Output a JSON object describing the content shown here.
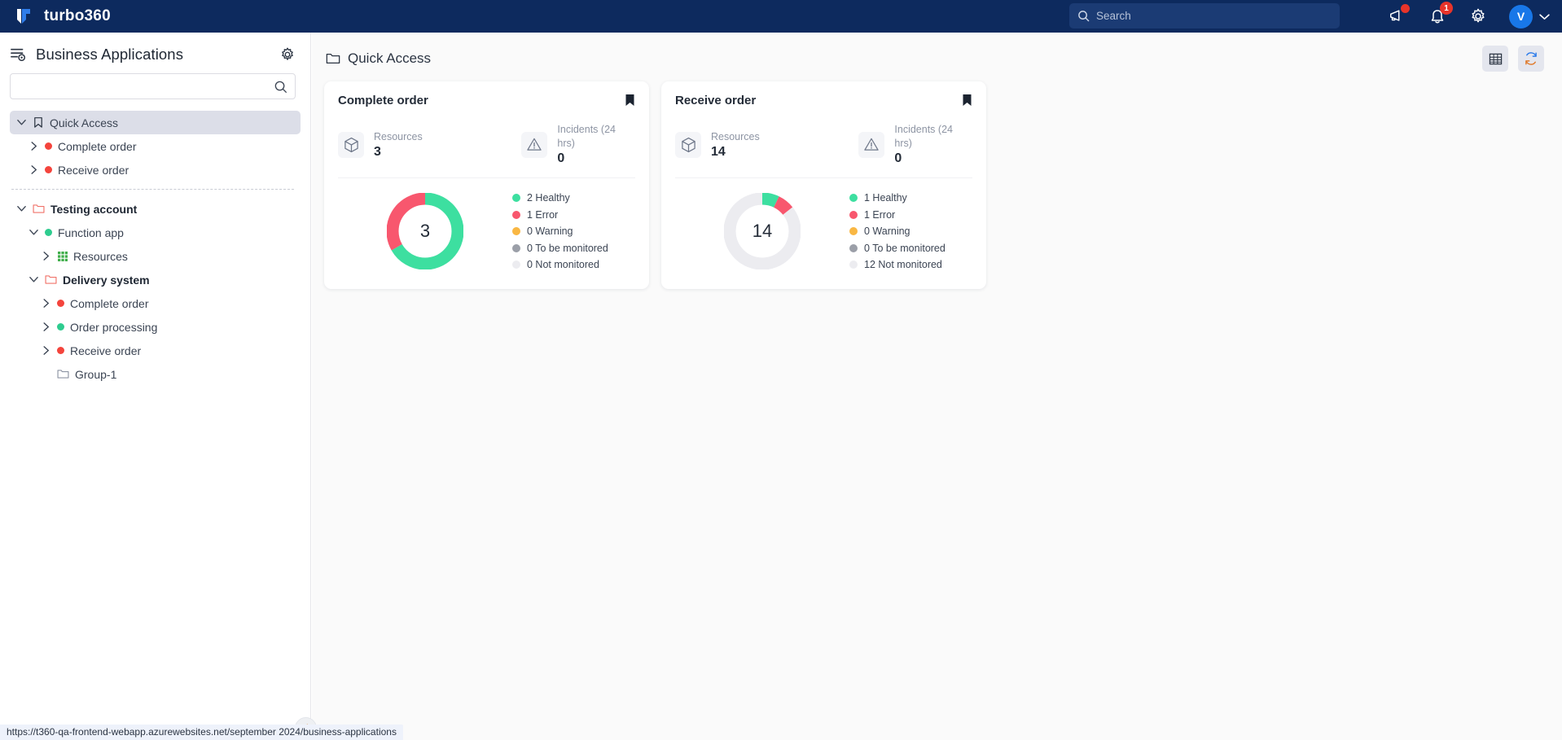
{
  "topbar": {
    "brand": "turbo360",
    "logo_icon": "turbo360-logo-icon",
    "search": {
      "value": "",
      "placeholder": "Search",
      "icon": "search-icon"
    },
    "megaphone": {
      "icon": "megaphone-icon",
      "has_alert": true
    },
    "notifications": {
      "icon": "bell-icon",
      "badge": "1"
    },
    "settings": {
      "icon": "gear-icon"
    },
    "avatar": {
      "initial": "V",
      "chevron": "chevron-down-icon",
      "color": "#1877e8"
    }
  },
  "sidebar": {
    "title": "Business Applications",
    "title_icon": "business-applications-icon",
    "gear_icon": "gear-icon",
    "search": {
      "value": "",
      "placeholder": "",
      "icon": "search-icon"
    },
    "collapse_icon": "chevron-left-icon",
    "tree": [
      {
        "label": "Quick Access",
        "icon": "bookmark-icon",
        "chevron": "chevron-down-icon",
        "indent": 0,
        "selected": true,
        "bold": false,
        "status": null
      },
      {
        "label": "Complete order",
        "icon": null,
        "chevron": "chevron-right-icon",
        "indent": 1,
        "selected": false,
        "bold": false,
        "status": "#f4443c"
      },
      {
        "label": "Receive order",
        "icon": null,
        "chevron": "chevron-right-icon",
        "indent": 1,
        "selected": false,
        "bold": false,
        "status": "#f4443c"
      },
      {
        "separator": true
      },
      {
        "label": "Testing account",
        "icon": "folder-icon",
        "icon_color": "#f0736a",
        "chevron": "chevron-down-icon",
        "indent": 0,
        "selected": false,
        "bold": true,
        "status": null
      },
      {
        "label": "Function app",
        "icon": null,
        "chevron": "chevron-down-icon",
        "indent": 1,
        "selected": false,
        "bold": false,
        "status": "#2ecc8f"
      },
      {
        "label": "Resources",
        "icon": "grid-icon",
        "icon_color": "#3fae4a",
        "chevron": "chevron-right-icon",
        "indent": 2,
        "selected": false,
        "bold": false,
        "status": null
      },
      {
        "label": "Delivery system",
        "icon": "folder-icon",
        "icon_color": "#f0736a",
        "chevron": "chevron-down-icon",
        "indent": 1,
        "selected": false,
        "bold": true,
        "status": null
      },
      {
        "label": "Complete order",
        "icon": null,
        "chevron": "chevron-right-icon",
        "indent": 2,
        "selected": false,
        "bold": false,
        "status": "#f4443c"
      },
      {
        "label": "Order processing",
        "icon": null,
        "chevron": "chevron-right-icon",
        "indent": 2,
        "selected": false,
        "bold": false,
        "status": "#2ecc8f"
      },
      {
        "label": "Receive order",
        "icon": null,
        "chevron": "chevron-right-icon",
        "indent": 2,
        "selected": false,
        "bold": false,
        "status": "#f4443c"
      },
      {
        "label": "Group-1",
        "icon": "folder-icon",
        "icon_color": "#8d94a3",
        "chevron": null,
        "indent": 2,
        "selected": false,
        "bold": false,
        "status": null
      }
    ]
  },
  "main": {
    "title": "Quick Access",
    "title_icon": "folder-icon",
    "actions": [
      {
        "name": "table-view-button",
        "icon": "table-icon"
      },
      {
        "name": "refresh-button",
        "icon": "refresh-icon"
      }
    ],
    "cards": [
      {
        "title": "Complete order",
        "bookmark_icon": "bookmark-filled-icon",
        "metrics": [
          {
            "label": "Resources",
            "value": "3",
            "icon": "cube-icon"
          },
          {
            "label": "Incidents (24 hrs)",
            "value": "0",
            "icon": "warning-triangle-icon"
          }
        ],
        "chart_data": {
          "type": "pie",
          "title": "Complete order resource health",
          "center_label": "3",
          "total": 3,
          "categories": [
            "Healthy",
            "Error",
            "Warning",
            "To be monitored",
            "Not monitored"
          ],
          "values": [
            2,
            1,
            0,
            0,
            0
          ],
          "colors": [
            "#3ddfa0",
            "#f8576e",
            "#f9b743",
            "#9b9fa8",
            "#ececf0"
          ],
          "legend_position": "right",
          "legend": [
            "2 Healthy",
            "1 Error",
            "0 Warning",
            "0 To be monitored",
            "0 Not monitored"
          ]
        }
      },
      {
        "title": "Receive order",
        "bookmark_icon": "bookmark-filled-icon",
        "metrics": [
          {
            "label": "Resources",
            "value": "14",
            "icon": "cube-icon"
          },
          {
            "label": "Incidents (24 hrs)",
            "value": "0",
            "icon": "warning-triangle-icon"
          }
        ],
        "chart_data": {
          "type": "pie",
          "title": "Receive order resource health",
          "center_label": "14",
          "total": 14,
          "categories": [
            "Healthy",
            "Error",
            "Warning",
            "To be monitored",
            "Not monitored"
          ],
          "values": [
            1,
            1,
            0,
            0,
            12
          ],
          "colors": [
            "#3ddfa0",
            "#f8576e",
            "#f9b743",
            "#9b9fa8",
            "#ececf0"
          ],
          "legend_position": "right",
          "legend": [
            "1 Healthy",
            "1 Error",
            "0 Warning",
            "0 To be monitored",
            "12 Not monitored"
          ]
        }
      }
    ]
  },
  "statusbar": {
    "url": "https://t360-qa-frontend-webapp.azurewebsites.net/september 2024/business-applications"
  }
}
